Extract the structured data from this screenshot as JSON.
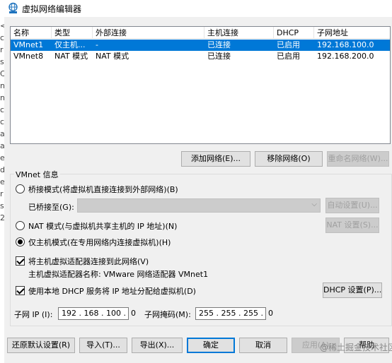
{
  "window": {
    "title": "虚拟网络编辑器"
  },
  "left_strip_chars": [
    "<",
    "c",
    "r",
    "s",
    "C",
    "n",
    "n",
    "c",
    "c",
    "a",
    "a",
    "e",
    "d",
    "e",
    "r",
    "s",
    "2"
  ],
  "table": {
    "headers": [
      "名称",
      "类型",
      "外部连接",
      "主机连接",
      "DHCP",
      "子网地址"
    ],
    "rows": [
      {
        "name": "VMnet1",
        "type": "仅主机...",
        "external": "-",
        "host": "已连接",
        "dhcp": "已启用",
        "subnet": "192.168.100.0",
        "selected": true
      },
      {
        "name": "VMnet8",
        "type": "NAT 模式",
        "external": "NAT 模式",
        "host": "已连接",
        "dhcp": "已启用",
        "subnet": "192.168.200.0",
        "selected": false
      }
    ]
  },
  "list_buttons": {
    "add": "添加网络(E)...",
    "remove": "移除网络(O)",
    "rename": "重命名网络(W)..."
  },
  "vmnet_info": {
    "group_label": "VMnet 信息",
    "bridge_label": "桥接模式(将虚拟机直接连接到外部网络)(B)",
    "bridged_to_label": "已桥接至(G):",
    "bridged_to_value": "",
    "auto_settings": "自动设置(U)...",
    "nat_label": "NAT 模式(与虚拟机共享主机的 IP 地址)(N)",
    "nat_settings": "NAT 设置(S)...",
    "hostonly_label": "仅主机模式(在专用网络内连接虚拟机)(H)",
    "connect_adapter_label": "将主机虚拟适配器连接到此网络(V)",
    "adapter_name_label": "主机虚拟适配器名称: VMware 网络适配器 VMnet1",
    "dhcp_label": "使用本地 DHCP 服务将 IP 地址分配给虚拟机(D)",
    "dhcp_settings": "DHCP 设置(P)...",
    "subnet_ip_label": "子网 IP (I):",
    "subnet_ip_value": "192 . 168 . 100 .  0",
    "subnet_mask_label": "子网掩码(M):",
    "subnet_mask_value": "255 . 255 . 255 .  0",
    "mode": "hostonly",
    "connect_adapter": true,
    "use_dhcp": true
  },
  "footer": {
    "restore": "还原默认设置(R)",
    "import": "导入(T)...",
    "export": "导出(X)...",
    "ok": "确定",
    "cancel": "取消",
    "apply": "应用(A)",
    "help": "帮助"
  },
  "watermark": "@稀土掘金技术社区",
  "colors": {
    "selection": "#0078d7",
    "window_bg": "#f0f0f0",
    "title_icon": "#1e73be"
  }
}
